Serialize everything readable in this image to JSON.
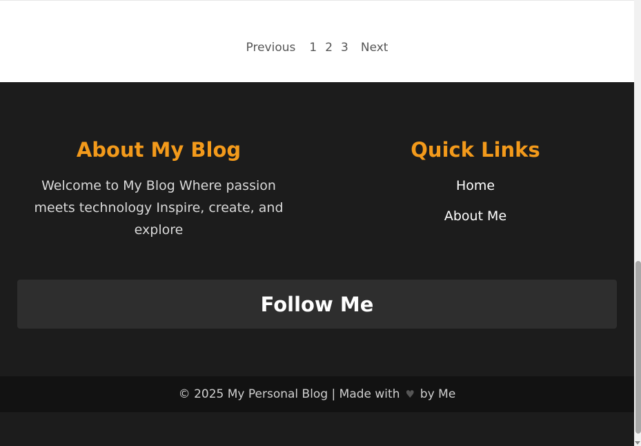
{
  "pagination": {
    "previous": "Previous",
    "pages": [
      "1",
      "2",
      "3"
    ],
    "next": "Next"
  },
  "footer": {
    "about": {
      "heading": "About My Blog",
      "text": "Welcome to My Blog Where passion meets technology Inspire, create, and explore"
    },
    "quick_links": {
      "heading": "Quick Links",
      "items": [
        {
          "label": "Home"
        },
        {
          "label": "About Me"
        }
      ]
    },
    "follow": {
      "heading": "Follow Me"
    },
    "copyright": {
      "before": "© 2025 My Personal Blog | Made with",
      "icon": "heart-icon",
      "after": "by Me"
    }
  },
  "colors": {
    "accent": "#f39a1b",
    "footer_bg": "#1c1c1c",
    "follow_bg": "#2e2e2e",
    "copyright_bg": "#121212"
  }
}
